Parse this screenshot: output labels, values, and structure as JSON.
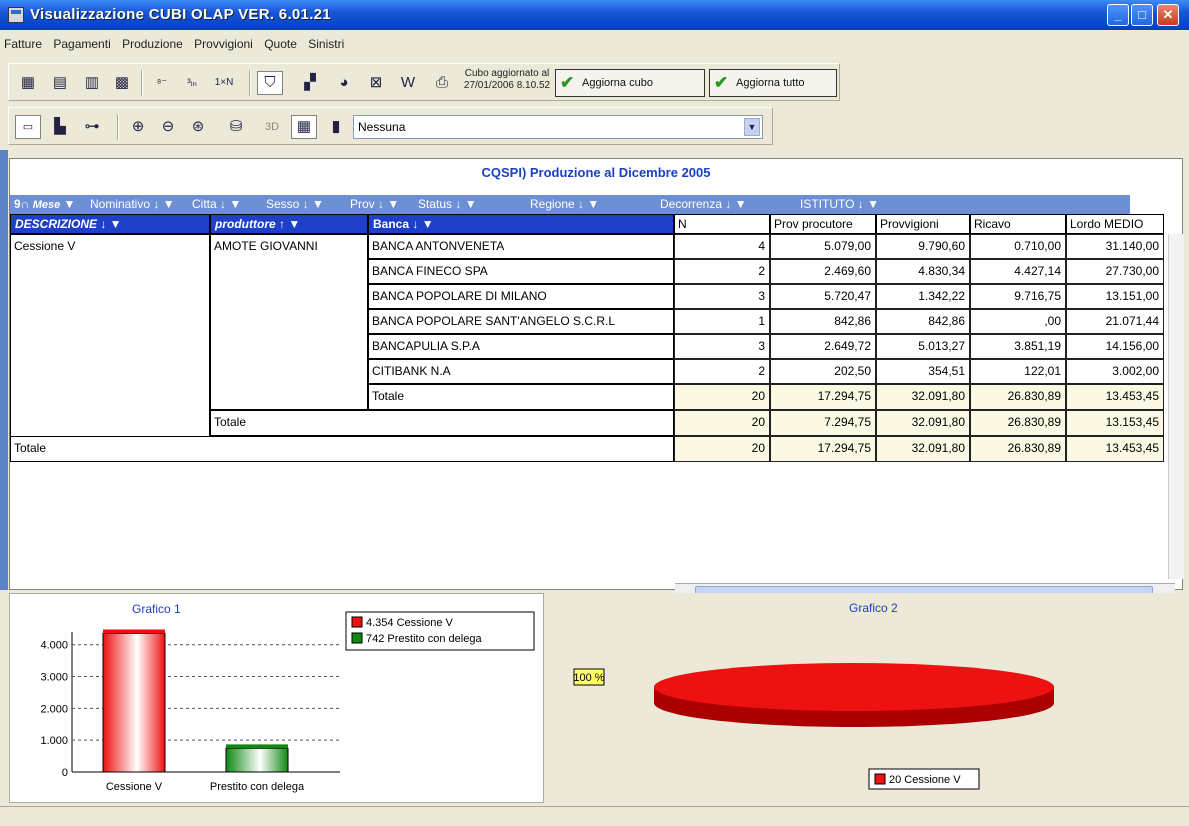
{
  "window": {
    "title": "Visualizzazione CUBI OLAP  VER. 6.01.21"
  },
  "menu": [
    "Fatture",
    "Pagamenti",
    "Produzione",
    "Provvigioni",
    "Quote",
    "Sinistri"
  ],
  "toolbar": {
    "updated_label": "Cubo aggiornato al",
    "updated_value": "27/01/2006 8.10.52",
    "refresh_cube": "Aggiorna cubo",
    "refresh_all": "Aggiorna tutto",
    "mode_3d": "3D",
    "combo_value": "Nessuna",
    "icons": [
      "pivot-icon",
      "table-icon",
      "grid-icon",
      "percent-grid-icon",
      "sort-asc-icon",
      "sort-desc-icon",
      "1xn-icon",
      "filter-icon",
      "chart-icon",
      "globe-icon",
      "excel-export-icon",
      "word-export-icon",
      "print-icon"
    ],
    "icons2": [
      "layout-icon",
      "chart-type-icon",
      "tree-icon",
      "zoom-in-icon",
      "zoom-out-icon",
      "zoom-fit-icon",
      "paint-icon",
      "grid-toggle-icon",
      "bar-view-icon"
    ]
  },
  "report": {
    "title": "CQSPI) Produzione  al  Dicembre 2005",
    "dimensions": [
      "Mese",
      "Nominativo",
      "Citta",
      "Sesso",
      "Prov",
      "Status",
      "Regione",
      "Decorrenza",
      "ISTITUTO"
    ],
    "row_headers": {
      "descrizione": "DESCRIZIONE",
      "produttore": "produttore",
      "banca": "Banca"
    },
    "measure_headers": [
      "N",
      "Prov procutore",
      "Provvigioni",
      "Ricavo",
      "Lordo MEDIO"
    ],
    "group": "Cessione V",
    "producer": "AMOTE GIOVANNI",
    "rows": [
      {
        "banca": "BANCA ANTONVENETA",
        "n": "4",
        "prov_prod": "5.079,00",
        "provv": "9.790,60",
        "ricavo": "0.710,00",
        "lordo": "31.140,00"
      },
      {
        "banca": "BANCA FINECO SPA",
        "n": "2",
        "prov_prod": "2.469,60",
        "provv": "4.830,34",
        "ricavo": "4.427,14",
        "lordo": "27.730,00"
      },
      {
        "banca": "BANCA POPOLARE DI MILANO",
        "n": "3",
        "prov_prod": "5.720,47",
        "provv": "1.342,22",
        "ricavo": "9.716,75",
        "lordo": "13.151,00"
      },
      {
        "banca": "BANCA POPOLARE SANT'ANGELO S.C.R.L",
        "n": "1",
        "prov_prod": "842,86",
        "provv": "842,86",
        "ricavo": ",00",
        "lordo": "21.071,44"
      },
      {
        "banca": "BANCAPULIA S.P.A",
        "n": "3",
        "prov_prod": "2.649,72",
        "provv": "5.013,27",
        "ricavo": "3.851,19",
        "lordo": "14.156,00"
      },
      {
        "banca": "CITIBANK N.A",
        "n": "2",
        "prov_prod": "202,50",
        "provv": "354,51",
        "ricavo": "122,01",
        "lordo": "3.002,00"
      }
    ],
    "totals": [
      {
        "label": "Totale",
        "n": "20",
        "prov_prod": "17.294,75",
        "provv": "32.091,80",
        "ricavo": "26.830,89",
        "lordo": "13.453,45"
      },
      {
        "label": "Totale",
        "n": "20",
        "prov_prod": "7.294,75",
        "provv": "32.091,80",
        "ricavo": "26.830,89",
        "lordo": "13.153,45"
      },
      {
        "label": "Totale",
        "n": "20",
        "prov_prod": "17.294,75",
        "provv": "32.091,80",
        "ricavo": "26.830,89",
        "lordo": "13.453,45"
      }
    ]
  },
  "chart_data": [
    {
      "type": "bar",
      "title": "Grafico 1",
      "categories": [
        "Cessione V",
        "Prestito con delega"
      ],
      "values": [
        4354,
        742
      ],
      "ylim": [
        0,
        4400
      ],
      "yticks": [
        "0",
        "1.000",
        "2.000",
        "3.000",
        "4.000"
      ],
      "legend": [
        "4.354 Cessione V",
        "742 Prestito con delega"
      ],
      "colors": [
        "#ee1111",
        "#118811"
      ]
    },
    {
      "type": "pie",
      "title": "Grafico 2",
      "slices": [
        {
          "label": "20 Cessione V",
          "value": 20,
          "percent": "100 %"
        }
      ],
      "colors": [
        "#ee1111"
      ]
    }
  ]
}
